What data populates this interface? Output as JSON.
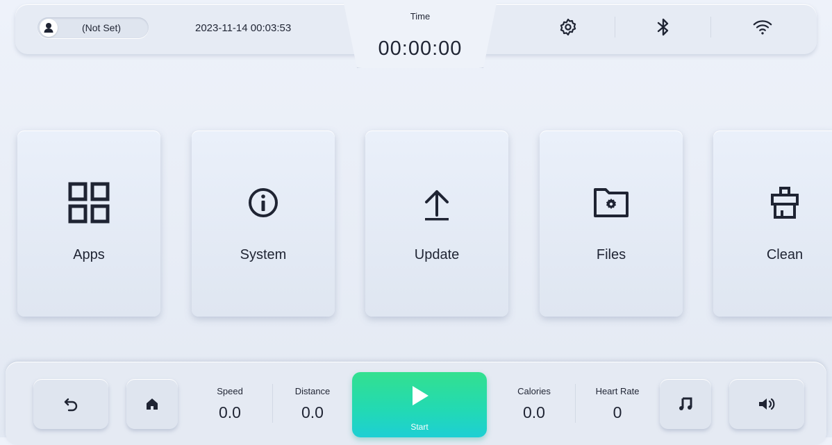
{
  "header": {
    "user_name": "(Not Set)",
    "datetime": "2023-11-14 00:03:53",
    "time_label": "Time",
    "time_value": "00:00:00"
  },
  "cards": [
    {
      "label": "Apps",
      "icon": "grid-icon"
    },
    {
      "label": "System",
      "icon": "info-icon"
    },
    {
      "label": "Update",
      "icon": "upload-icon"
    },
    {
      "label": "Files",
      "icon": "folder-settings-icon"
    },
    {
      "label": "Clean",
      "icon": "clean-icon"
    }
  ],
  "bottom": {
    "speed_label": "Speed",
    "speed_value": "0.0",
    "distance_label": "Distance",
    "distance_value": "0.0",
    "start_label": "Start",
    "calories_label": "Calories",
    "calories_value": "0.0",
    "heart_rate_label": "Heart Rate",
    "heart_rate_value": "0"
  },
  "colors": {
    "accent_start": "#33e08f",
    "accent_end": "#1dcfd4",
    "text": "#1f2433",
    "background": "#e8edf5"
  }
}
